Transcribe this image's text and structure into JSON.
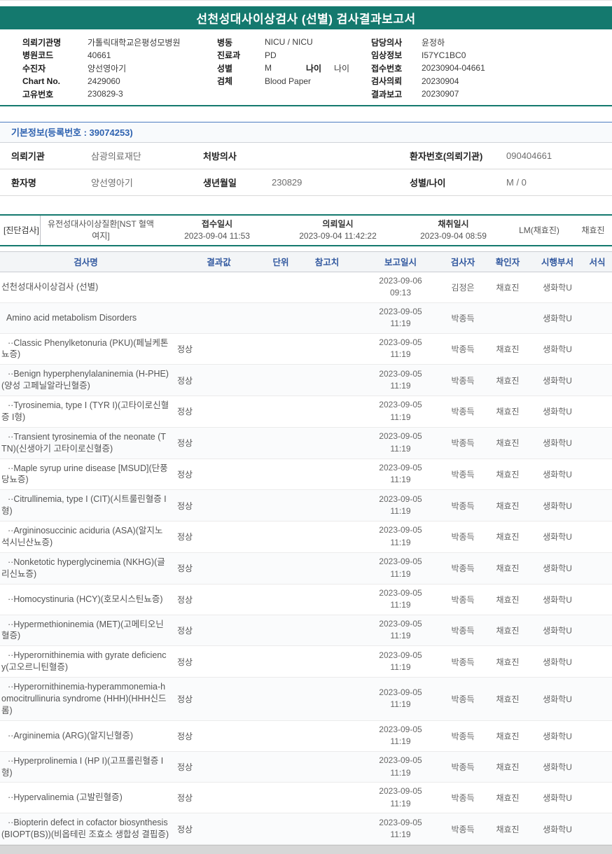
{
  "title": "선천성대사이상검사 (선별) 검사결과보고서",
  "patient_info": {
    "left": [
      {
        "label": "의뢰기관명",
        "value": "가톨릭대학교은평성모병원"
      },
      {
        "label": "병원코드",
        "value": "40661"
      },
      {
        "label": "수진자",
        "value": "양선영아기"
      },
      {
        "label": "Chart No.",
        "value": "2429060"
      },
      {
        "label": "고유번호",
        "value": "230829-3"
      }
    ],
    "middle": [
      {
        "label": "병동",
        "value": "NICU / NICU"
      },
      {
        "label": "진료과",
        "value": "PD"
      },
      {
        "label": "성별",
        "value": "M",
        "label2": "나이",
        "value2": "나이"
      },
      {
        "label": "검체",
        "value": "Blood Paper"
      }
    ],
    "right": [
      {
        "label": "담당의사",
        "value": "윤정하"
      },
      {
        "label": "임상정보",
        "value": "I57YC1BC0"
      },
      {
        "label": "접수번호",
        "value": "20230904-04661"
      },
      {
        "label": "검사의뢰",
        "value": "20230904"
      },
      {
        "label": "결과보고",
        "value": "20230907"
      }
    ]
  },
  "basic_info": {
    "header": "기본정보(등록번호 : 39074253)",
    "rows": [
      [
        {
          "label": "의뢰기관",
          "value": "삼광의료재단"
        },
        {
          "label": "처방의사",
          "value": ""
        },
        {
          "label": "환자번호(의뢰기관)",
          "value": "090404661"
        }
      ],
      [
        {
          "label": "환자명",
          "value": "양선영아기"
        },
        {
          "label": "생년월일",
          "value": "230829"
        },
        {
          "label": "성별/나이",
          "value": "M / 0"
        }
      ]
    ]
  },
  "diagnosis_band": {
    "tag": "[진단검사]",
    "test_group": "유전성대사이상질환[NST 혈액 여지]",
    "items": [
      {
        "label": "접수일시",
        "value": "2023-09-04 11:53"
      },
      {
        "label": "의뢰일시",
        "value": "2023-09-04 11:42:22"
      },
      {
        "label": "채취일시",
        "value": "2023-09-04 08:59"
      }
    ],
    "collector": "LM(채효진)",
    "confirmer": "채효진"
  },
  "results_table": {
    "headers": [
      "검사명",
      "결과값",
      "단위",
      "참고치",
      "보고일시",
      "검사자",
      "확인자",
      "시행부서",
      "서식"
    ],
    "rows": [
      {
        "name": "선천성대사이상검사 (선별)",
        "indent": 0,
        "result": "",
        "unit": "",
        "ref": "",
        "report_date": "2023-09-06",
        "report_time": "09:13",
        "examiner": "김정은",
        "confirmer": "채효진",
        "dept": "생화학U",
        "form": ""
      },
      {
        "name": "Amino acid metabolism Disorders",
        "indent": 1,
        "result": "",
        "unit": "",
        "ref": "",
        "report_date": "2023-09-05",
        "report_time": "11:19",
        "examiner": "박종득",
        "confirmer": "",
        "dept": "생화학U",
        "form": ""
      },
      {
        "name": "··Classic Phenylketonuria (PKU)(페닐케톤뇨증)",
        "indent": 2,
        "result": "정상",
        "unit": "",
        "ref": "",
        "report_date": "2023-09-05",
        "report_time": "11:19",
        "examiner": "박종득",
        "confirmer": "채효진",
        "dept": "생화학U",
        "form": ""
      },
      {
        "name": "··Benign hyperphenylalaninemia (H-PHE)(양성 고페닐알라닌혈증)",
        "indent": 2,
        "result": "정상",
        "unit": "",
        "ref": "",
        "report_date": "2023-09-05",
        "report_time": "11:19",
        "examiner": "박종득",
        "confirmer": "채효진",
        "dept": "생화학U",
        "form": ""
      },
      {
        "name": "··Tyrosinemia, type I (TYR I)(고타이로신혈증 I형)",
        "indent": 2,
        "result": "정상",
        "unit": "",
        "ref": "",
        "report_date": "2023-09-05",
        "report_time": "11:19",
        "examiner": "박종득",
        "confirmer": "채효진",
        "dept": "생화학U",
        "form": ""
      },
      {
        "name": "··Transient tyrosinemia of the neonate (TTN)(신생아기 고타이로신혈증)",
        "indent": 2,
        "result": "정상",
        "unit": "",
        "ref": "",
        "report_date": "2023-09-05",
        "report_time": "11:19",
        "examiner": "박종득",
        "confirmer": "채효진",
        "dept": "생화학U",
        "form": ""
      },
      {
        "name": "··Maple syrup urine disease [MSUD](단풍당뇨증)",
        "indent": 2,
        "result": "정상",
        "unit": "",
        "ref": "",
        "report_date": "2023-09-05",
        "report_time": "11:19",
        "examiner": "박종득",
        "confirmer": "채효진",
        "dept": "생화학U",
        "form": ""
      },
      {
        "name": "··Citrullinemia, type I (CIT)(시트룰린혈증 I형)",
        "indent": 2,
        "result": "정상",
        "unit": "",
        "ref": "",
        "report_date": "2023-09-05",
        "report_time": "11:19",
        "examiner": "박종득",
        "confirmer": "채효진",
        "dept": "생화학U",
        "form": ""
      },
      {
        "name": "··Argininosuccinic aciduria (ASA)(알지노석시닌산뇨증)",
        "indent": 2,
        "result": "정상",
        "unit": "",
        "ref": "",
        "report_date": "2023-09-05",
        "report_time": "11:19",
        "examiner": "박종득",
        "confirmer": "채효진",
        "dept": "생화학U",
        "form": ""
      },
      {
        "name": "··Nonketotic hyperglycinemia (NKHG)(글리신뇨증)",
        "indent": 2,
        "result": "정상",
        "unit": "",
        "ref": "",
        "report_date": "2023-09-05",
        "report_time": "11:19",
        "examiner": "박종득",
        "confirmer": "채효진",
        "dept": "생화학U",
        "form": ""
      },
      {
        "name": "··Homocystinuria (HCY)(호모시스틴뇨증)",
        "indent": 2,
        "result": "정상",
        "unit": "",
        "ref": "",
        "report_date": "2023-09-05",
        "report_time": "11:19",
        "examiner": "박종득",
        "confirmer": "채효진",
        "dept": "생화학U",
        "form": ""
      },
      {
        "name": "··Hypermethioninemia (MET)(고메티오닌혈증)",
        "indent": 2,
        "result": "정상",
        "unit": "",
        "ref": "",
        "report_date": "2023-09-05",
        "report_time": "11:19",
        "examiner": "박종득",
        "confirmer": "채효진",
        "dept": "생화학U",
        "form": ""
      },
      {
        "name": "··Hyperornithinemia with gyrate deficiency(고오르니틴혈증)",
        "indent": 2,
        "result": "정상",
        "unit": "",
        "ref": "",
        "report_date": "2023-09-05",
        "report_time": "11:19",
        "examiner": "박종득",
        "confirmer": "채효진",
        "dept": "생화학U",
        "form": ""
      },
      {
        "name": "··Hyperornithinemia-hyperammonemia-homocitrullinuria syndrome (HHH)(HHH신드롬)",
        "indent": 2,
        "result": "정상",
        "unit": "",
        "ref": "",
        "report_date": "2023-09-05",
        "report_time": "11:19",
        "examiner": "박종득",
        "confirmer": "채효진",
        "dept": "생화학U",
        "form": ""
      },
      {
        "name": "··Argininemia (ARG)(알지닌혈증)",
        "indent": 2,
        "result": "정상",
        "unit": "",
        "ref": "",
        "report_date": "2023-09-05",
        "report_time": "11:19",
        "examiner": "박종득",
        "confirmer": "채효진",
        "dept": "생화학U",
        "form": ""
      },
      {
        "name": "··Hyperprolinemia I (HP I)(고프롤린혈증 I형)",
        "indent": 2,
        "result": "정상",
        "unit": "",
        "ref": "",
        "report_date": "2023-09-05",
        "report_time": "11:19",
        "examiner": "박종득",
        "confirmer": "채효진",
        "dept": "생화학U",
        "form": ""
      },
      {
        "name": "··Hypervalinemia (고발린혈증)",
        "indent": 2,
        "result": "정상",
        "unit": "",
        "ref": "",
        "report_date": "2023-09-05",
        "report_time": "11:19",
        "examiner": "박종득",
        "confirmer": "채효진",
        "dept": "생화학U",
        "form": ""
      },
      {
        "name": "··Biopterin defect in cofactor biosynthesis (BIOPT(BS))(비옵테린 조효소 생합성 결핍증)",
        "indent": 2,
        "result": "정상",
        "unit": "",
        "ref": "",
        "report_date": "2023-09-05",
        "report_time": "11:19",
        "examiner": "박종득",
        "confirmer": "채효진",
        "dept": "생화학U",
        "form": ""
      }
    ]
  }
}
